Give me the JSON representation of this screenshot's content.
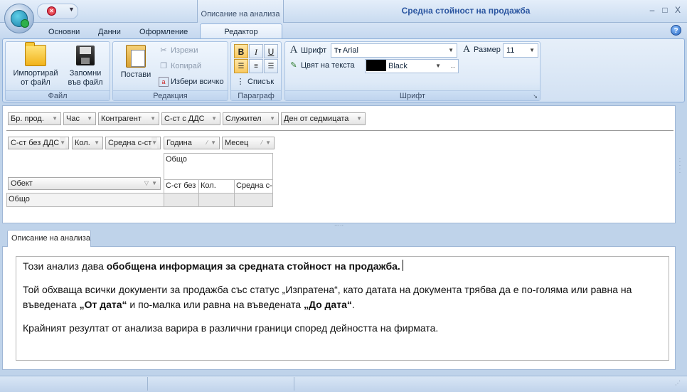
{
  "window": {
    "title": "Средна стойност на продажба",
    "context_group": "Описание на анализа",
    "controls": {
      "minimize": "–",
      "maximize": "□",
      "close": "X"
    }
  },
  "tabs": [
    {
      "label": "Основни"
    },
    {
      "label": "Данни"
    },
    {
      "label": "Оформление"
    },
    {
      "label": "Редактор"
    }
  ],
  "help": "?",
  "ribbon": {
    "file": {
      "group_label": "Файл",
      "import_line1": "Импортирай",
      "import_line2": "от файл",
      "save_line1": "Запомни",
      "save_line2": "във файл"
    },
    "edit": {
      "group_label": "Редакция",
      "paste": "Постави",
      "cut": "Изрежи",
      "copy": "Копирай",
      "select_all": "Избери всичко"
    },
    "paragraph": {
      "group_label": "Параграф",
      "bold": "B",
      "italic": "I",
      "underline": "U",
      "list": "Списък"
    },
    "font": {
      "group_label": "Шрифт",
      "font_label": "Шрифт",
      "font_value": "Arial",
      "color_label": "Цвят на текста",
      "color_value": "Black",
      "color_swatch": "#000000",
      "size_label": "Размер",
      "size_value": "11"
    }
  },
  "pivot": {
    "filter_fields": [
      "Бр. прод.",
      "Час",
      "Контрагент",
      "С-ст с ДДС",
      "Служител",
      "Ден от седмицата"
    ],
    "data_fields": [
      "С-ст без ДДС",
      "Кол.",
      "Средна с-ст"
    ],
    "column_fields": [
      "Година",
      "Месец"
    ],
    "row_field": "Обект",
    "column_header": "Общо",
    "column_subheaders": [
      "С-ст без",
      "Кол.",
      "Средна с-"
    ],
    "row_total": "Общо"
  },
  "description": {
    "tab_label": "Описание на анализа",
    "p1_normal": "Този анализ дава ",
    "p1_bold": "обобщена информация за средната стойност на продажба.",
    "p2_a": "Той обхваща всички документи за продажба със статус „Изпратена“, като датата на документа трябва да е по-голяма или равна на въведената ",
    "p2_bold1": "„От дата“",
    "p2_b": " и по-малка или равна на въведената ",
    "p2_bold2": "„До дата“",
    "p2_c": ".",
    "p3": "Крайният резултат от анализа варира в различни граници според дейността на фирмата."
  }
}
